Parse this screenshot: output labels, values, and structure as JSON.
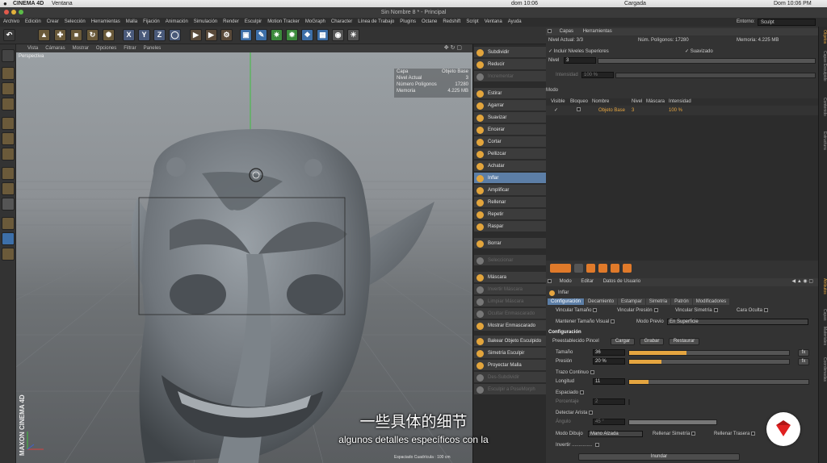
{
  "mac_menubar": {
    "app": "CINEMA 4D",
    "menu": "Ventana",
    "clock_left": "dom 10:06",
    "status": "Cargada",
    "clock_right": "Dom 10:06 PM"
  },
  "window_title": "Sin Nombre 8 * - Principal",
  "main_menu": [
    "Archivo",
    "Edición",
    "Crear",
    "Selección",
    "Herramientas",
    "Malla",
    "Fijación",
    "Animación",
    "Simulación",
    "Render",
    "Esculpir",
    "Motion Tracker",
    "MoGraph",
    "Character",
    "Línea de Trabajo",
    "Plugins",
    "Octane",
    "Redshift",
    "Script",
    "Ventana",
    "Ayuda"
  ],
  "environment": {
    "label": "Entorno:",
    "value": "Sculpt"
  },
  "axis_buttons": [
    "X",
    "Y",
    "Z"
  ],
  "viewport": {
    "menu": [
      "Vista",
      "Cámaras",
      "Mostrar",
      "Opciones",
      "Filtrar",
      "Paneles"
    ],
    "camera_label": "Perspectiva",
    "hud": [
      {
        "k": "Capa",
        "v": "Objeto Base"
      },
      {
        "k": "Nivel Actual",
        "v": "3"
      },
      {
        "k": "Número Polígonos",
        "v": "17280"
      },
      {
        "k": "Memoria",
        "v": "4.225 MB"
      }
    ],
    "grid_label": "Espaciado Cuadrícula : 100 cm",
    "colors": {
      "sky": "#9aa0a4",
      "floor": "#5a5d60",
      "model": "#7b8186",
      "axis_y": "#3fbf3f"
    }
  },
  "brush_tools": [
    {
      "label": "Subdividir",
      "state": "normal"
    },
    {
      "label": "Reducir",
      "state": "normal"
    },
    {
      "label": "Incrementar",
      "state": "disabled"
    },
    {
      "label": "Estirar",
      "state": "normal"
    },
    {
      "label": "Agarrar",
      "state": "normal"
    },
    {
      "label": "Suavizar",
      "state": "normal"
    },
    {
      "label": "Encerar",
      "state": "normal"
    },
    {
      "label": "Cortar",
      "state": "normal"
    },
    {
      "label": "Pellizcar",
      "state": "normal"
    },
    {
      "label": "Achatar",
      "state": "normal"
    },
    {
      "label": "Inflar",
      "state": "selected"
    },
    {
      "label": "Amplificar",
      "state": "normal"
    },
    {
      "label": "Rellenar",
      "state": "normal"
    },
    {
      "label": "Repetir",
      "state": "normal"
    },
    {
      "label": "Raspar",
      "state": "normal"
    },
    {
      "label": "Borrar",
      "state": "normal"
    },
    {
      "label": "Seleccionar",
      "state": "disabled"
    },
    {
      "label": "Máscara",
      "state": "normal"
    },
    {
      "label": "Invertir Máscara",
      "state": "disabled"
    },
    {
      "label": "Limpiar Máscara",
      "state": "disabled"
    },
    {
      "label": "Ocultar Enmascarado",
      "state": "disabled"
    },
    {
      "label": "Mostrar Enmascarado",
      "state": "normal"
    },
    {
      "label": "Bakear Objeto Esculpido",
      "state": "normal"
    },
    {
      "label": "Simetría Esculpir",
      "state": "normal"
    },
    {
      "label": "Proyectar Malla",
      "state": "normal"
    },
    {
      "label": "Des-Subdividir",
      "state": "disabled"
    },
    {
      "label": "Esculpir a PoseMorph",
      "state": "disabled"
    }
  ],
  "layers": {
    "tabs": [
      "Capas",
      "Herramientas"
    ],
    "nivel_actual": "Nivel Actual: 3/3",
    "num_poligonos": "Núm. Polígonos: 17280",
    "memoria": "Memoria: 4.225 MB",
    "incluir": "Incluir Niveles Superiores",
    "suavizado": "Suavizado",
    "nivel_label": "Nivel",
    "nivel_value": "3",
    "intensidad_label": "Intensidad",
    "intensidad_value": "100 %",
    "modo_label": "Modo",
    "columns": [
      "Visible",
      "Bloqueo",
      "Nombre",
      "Nivel",
      "Máscara",
      "Intensidad"
    ],
    "row": {
      "name": "Objeto Base",
      "level": "3",
      "intensity": "100 %"
    }
  },
  "attributes": {
    "header_tabs": [
      "Modo",
      "Editar",
      "Datos de Usuario"
    ],
    "tool_name": "Inflar",
    "tabs": [
      "Configuración",
      "Decamiento",
      "Estampar",
      "Simetría",
      "Patrón",
      "Modificadores"
    ],
    "active_tab": 0,
    "vincular_tamano": "Vincular Tamaño",
    "vincular_presion": "Vincular Presión",
    "vincular_simetria": "Vincular Simetría",
    "cara_oculta": "Cara Oculta",
    "mantener_tamano": "Mantener Tamaño Visual",
    "modo_previo_label": "Modo Previo",
    "modo_previo_value": "En Superficie",
    "section": "Configuración",
    "preset_label": "Preestablecido Pincel",
    "buttons": [
      "Cargar",
      "Grabar",
      "Restaurar"
    ],
    "tamano_label": "Tamaño",
    "tamano_value": "36",
    "tamano_fraction": 0.36,
    "presion_label": "Presión",
    "presion_value": "20 %",
    "presion_fraction": 0.2,
    "trazo_continuo": "Trazo Continuo",
    "longitud_label": "Longitud",
    "longitud_value": "11",
    "longitud_fraction": 0.11,
    "espaciado": "Espaciado",
    "porcentaje_label": "Porcentaje",
    "porcentaje_value": "2",
    "detectar_arista": "Detectar Arista",
    "angulo_label": "Ángulo",
    "angulo_value": "45 °",
    "modo_dibujo_label": "Modo Dibujo",
    "modo_dibujo_value": "Mano Alzada",
    "rellenar_simetria": "Rellenar Simetría",
    "rellenar_trasera": "Rellenar Trasera",
    "invertir": "Invertir",
    "inundar_button": "Inundar",
    "fx": "fx"
  },
  "right_tabs": [
    "Objetos",
    "Capas Esculpido",
    "Contenido",
    "Estructura",
    "Atributos",
    "Capas",
    "Materiales",
    "Coordenadas"
  ],
  "subtitles": {
    "chinese": "一些具体的细节",
    "spanish": "algunos detalles específicos con la"
  },
  "brand": {
    "logo_color": "#e02020",
    "accent": "#e5a540",
    "selection": "#5c7ea6"
  }
}
